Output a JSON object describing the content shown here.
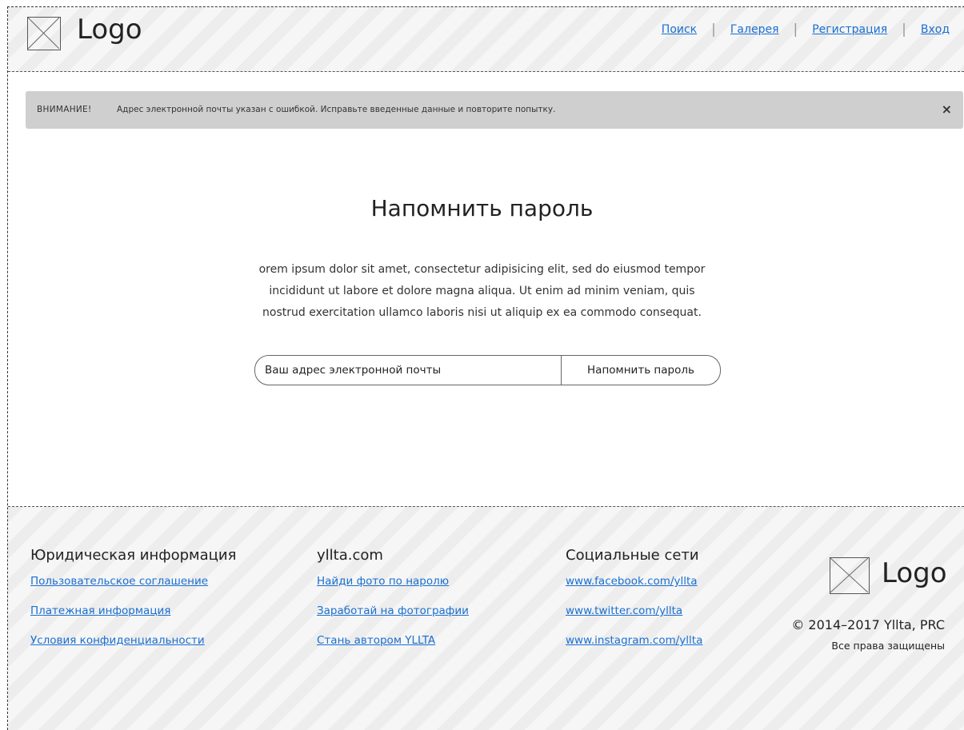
{
  "header": {
    "logo_text": "Logo",
    "nav": {
      "search": "Поиск",
      "gallery": "Галерея",
      "register": "Регистрация",
      "login": "Вход"
    }
  },
  "alert": {
    "label": "ВНИМАНИЕ!",
    "message": "Адрес электронной почты указан с ошибкой. Исправьте введенные данные и повторите попытку.",
    "close": "×"
  },
  "main": {
    "title": "Напомнить пароль",
    "lorem": [
      "orem ipsum dolor sit amet, consectetur adipisicing elit, sed do eiusmod tempor",
      "incididunt ut labore et dolore magna aliqua. Ut enim ad minim veniam, quis",
      "nostrud exercitation ullamco laboris nisi ut aliquip ex ea commodo consequat."
    ],
    "form": {
      "email_placeholder": "Ваш адрес электронной почты",
      "submit_label": "Напомнить пароль"
    }
  },
  "footer": {
    "legal": {
      "heading": "Юридическая информация",
      "links": [
        "Пользовательское соглашение",
        "Платежная информация",
        "Условия конфиденциальности"
      ]
    },
    "site": {
      "heading": "yllta.com",
      "links": [
        "Найди фото по наролю",
        "Заработай на фотографии",
        "Стань автором YLLTA"
      ]
    },
    "social": {
      "heading": "Социальные сети",
      "links": [
        "www.facebook.com/yllta",
        "www.twitter.com/yllta",
        "www.instagram.com/yllta"
      ]
    },
    "logo_text": "Logo",
    "copyright": "© 2014–2017 Yllta, PRC",
    "rights": "Все права защищены"
  }
}
